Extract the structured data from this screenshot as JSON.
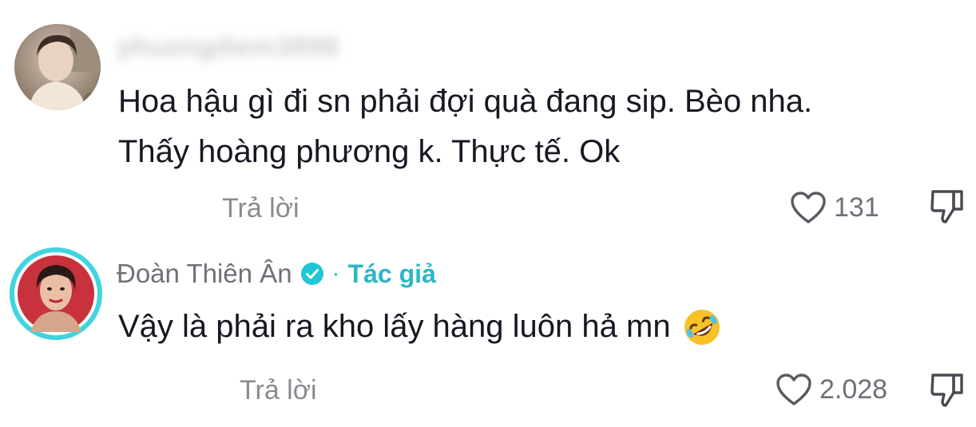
{
  "comments": [
    {
      "username": "phuongdiem3898",
      "text_lines": [
        "Hoa hậu gì đi sn phải đợi quà đang sip. Bèo nha.",
        "Thấy hoàng phương k. Thực tế. Ok"
      ],
      "reply_label": "Trả lời",
      "like_count": "131"
    },
    {
      "username": "Đoàn Thiên Ân",
      "verified": true,
      "separator": "·",
      "author_badge": "Tác giả",
      "text": "Vậy là phải ra kho lấy hàng luôn hả mn",
      "emoji": "rolling-on-floor-laughing-emoji",
      "reply_label": "Trả lời",
      "like_count": "2.028"
    }
  ],
  "colors": {
    "text": "#161823",
    "muted": "#8a8b91",
    "accent": "#2bb6c7",
    "avatar_ring": "#3fd4e0"
  },
  "icons": {
    "like": "heart-icon",
    "dislike": "thumbs-down-icon",
    "verified": "verified-check-icon"
  }
}
